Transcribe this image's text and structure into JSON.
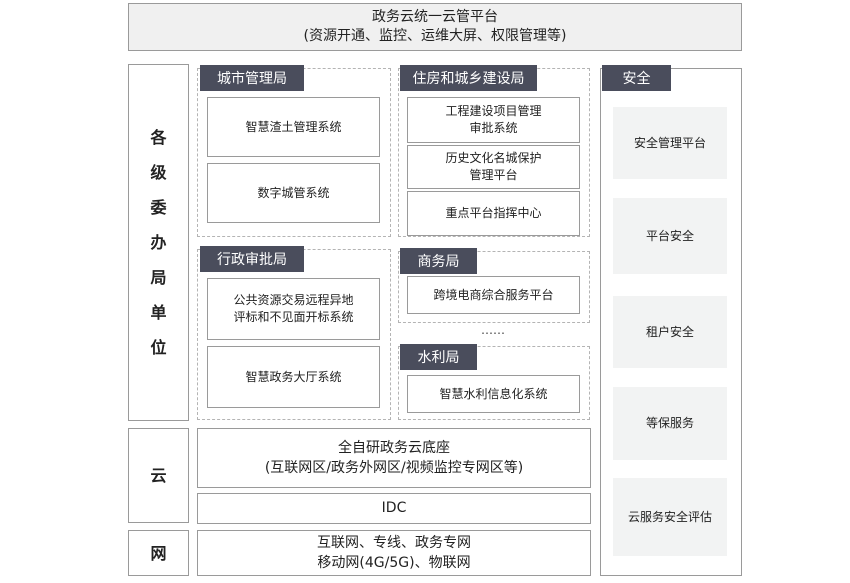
{
  "header": {
    "line1": "政务云统一云管平台",
    "line2": "(资源开通、监控、运维大屏、权限管理等)"
  },
  "left_labels": {
    "units": [
      "各",
      "级",
      "委",
      "办",
      "局",
      "单",
      "位"
    ],
    "cloud": "云",
    "network": "网"
  },
  "departments": {
    "city": {
      "title": "城市管理局",
      "items": [
        "智慧渣土管理系统",
        "数字城管系统"
      ]
    },
    "housing": {
      "title": "住房和城乡建设局",
      "items": [
        [
          "工程建设项目管理",
          "审批系统"
        ],
        [
          "历史文化名城保护",
          "管理平台"
        ],
        [
          "重点平台指挥中心"
        ]
      ]
    },
    "approval": {
      "title": "行政审批局",
      "items": [
        [
          "公共资源交易远程异地",
          "评标和不见面开标系统"
        ],
        [
          "智慧政务大厅系统"
        ]
      ]
    },
    "commerce": {
      "title": "商务局",
      "items": [
        "跨境电商综合服务平台"
      ]
    },
    "ellipsis": "……",
    "water": {
      "title": "水利局",
      "items": [
        "智慧水利信息化系统"
      ]
    }
  },
  "cloud_base": {
    "line1": "全自研政务云底座",
    "line2": "(互联网区/政务外网区/视频监控专网区等)",
    "idc": "IDC"
  },
  "network_box": {
    "line1": "互联网、专线、政务专网",
    "line2": "移动网(4G/5G)、物联网"
  },
  "security": {
    "title": "安全",
    "items": [
      "安全管理平台",
      "平台安全",
      "租户安全",
      "等保服务",
      "云服务安全评估"
    ]
  },
  "colors": {
    "tag_bg": "#4a4d5c",
    "header_bg": "#f0f0f0",
    "security_item_bg": "#f2f3f3",
    "border": "#9a9a9a"
  }
}
